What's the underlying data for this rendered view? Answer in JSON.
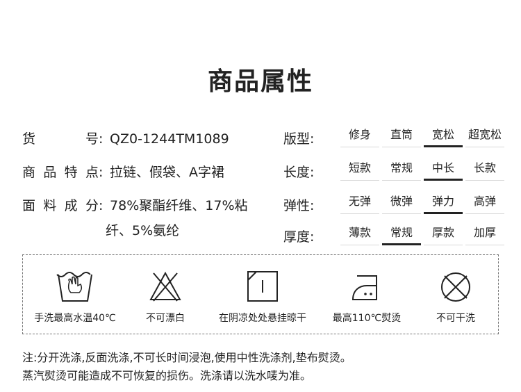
{
  "title": "商品属性",
  "left": {
    "sku_label": "货号",
    "sku_colon": ":",
    "sku_value": "QZ0-1244TM1089",
    "feature_label": "商品特点",
    "feature_colon": ":",
    "feature_value": "拉链、假袋、A字裙",
    "fabric_label": "面料成分",
    "fabric_colon": ":",
    "fabric_value_1": "78%聚酯纤维、17%粘",
    "fabric_value_2": "纤、5%氨纶"
  },
  "attrs": [
    {
      "label": "版型:",
      "options": [
        "修身",
        "直筒",
        "宽松",
        "超宽松"
      ],
      "selected": 2
    },
    {
      "label": "长度:",
      "options": [
        "短款",
        "常规",
        "中长",
        "长款"
      ],
      "selected": 2
    },
    {
      "label": "弹性:",
      "options": [
        "无弹",
        "微弹",
        "弹力",
        "高弹"
      ],
      "selected": 2
    },
    {
      "label": "厚度:",
      "options": [
        "薄款",
        "常规",
        "厚款",
        "加厚"
      ],
      "selected": 1
    }
  ],
  "care": [
    {
      "icon": "hand-wash-icon",
      "label": "手洗最高水温40℃"
    },
    {
      "icon": "no-bleach-icon",
      "label": "不可漂白"
    },
    {
      "icon": "line-dry-shade-icon",
      "label": "在阴凉处处悬挂晾干"
    },
    {
      "icon": "iron-medium-icon",
      "label": "最高110℃熨烫"
    },
    {
      "icon": "no-dry-clean-icon",
      "label": "不可干洗"
    }
  ],
  "note_line_1": "注:分开洗涤,反面洗涤,不可长时间浸泡,使用中性洗涤剂,垫布熨烫。",
  "note_line_2": "蒸汽熨烫可能造成不可恢复的损伤。洗涤请以洗水唛为准。"
}
